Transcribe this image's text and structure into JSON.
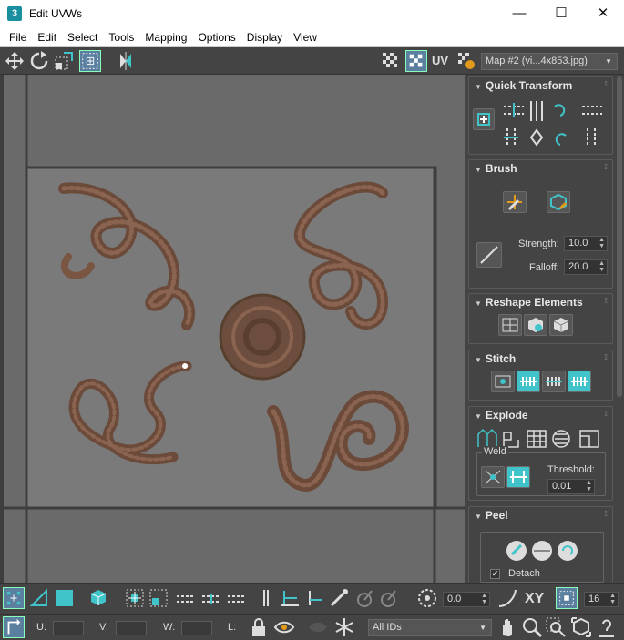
{
  "window": {
    "title": "Edit UVWs",
    "logo_text": "3",
    "minimize": "—",
    "maximize": "☐",
    "close": "✕"
  },
  "menu": [
    "File",
    "Edit",
    "Select",
    "Tools",
    "Mapping",
    "Options",
    "Display",
    "View"
  ],
  "toolbar": {
    "uv_label": "UV",
    "map_dropdown": "Map #2 (vi...4x853.jpg)"
  },
  "rollouts": {
    "quick_transform": {
      "title": "Quick Transform"
    },
    "brush": {
      "title": "Brush",
      "strength_label": "Strength:",
      "strength_value": "10.0",
      "falloff_label": "Falloff:",
      "falloff_value": "20.0"
    },
    "reshape": {
      "title": "Reshape Elements"
    },
    "stitch": {
      "title": "Stitch"
    },
    "explode": {
      "title": "Explode",
      "weld_label": "Weld",
      "threshold_label": "Threshold:",
      "threshold_value": "0.01"
    },
    "peel": {
      "title": "Peel",
      "detach_label": "Detach",
      "detach_checked": true
    }
  },
  "bottom_bar": {
    "spinner_value": "0.0",
    "xy_label": "XY",
    "count_value": "16",
    "u_label": "U:",
    "v_label": "V:",
    "w_label": "W:",
    "l_label": "L:",
    "ids_dropdown": "All IDs"
  },
  "colors": {
    "accent": "#40c4c9",
    "panel": "#444444",
    "viewport": "#6c6c6c"
  }
}
